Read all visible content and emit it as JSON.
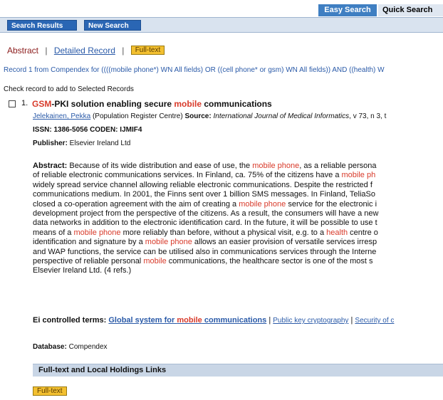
{
  "tabs_top": {
    "easy_search": "Easy Search",
    "quick_search": "Quick Search"
  },
  "nav": {
    "search_results": "Search Results",
    "new_search": "New Search"
  },
  "view_tabs": {
    "abstract": "Abstract",
    "separator": "|",
    "detailed": "Detailed Record",
    "fulltext": "Full-text"
  },
  "record_line": "Record 1 from Compendex for ((((mobile phone*) WN All fields) OR ((cell phone* or gsm) WN All fields)) AND ((health) W",
  "check_line": "Check record to add to Selected Records",
  "record": {
    "number": "1.",
    "title_hl": "GSM",
    "title_part1": "-PKI solution enabling secure ",
    "title_hl2": "mobile",
    "title_part2": " communications",
    "author": "Jelekainen, Pekka",
    "affiliation": " (Population Register Centre) ",
    "source_label": "Source:",
    "source_text": " International Journal of Medical Informatics",
    "source_tail": ", v 73, n 3, t",
    "issn_label": "ISSN:",
    "issn": " 1386-5056 ",
    "coden_label": "CODEN:",
    "coden": " IJMIF4",
    "publisher_label": "Publisher:",
    "publisher": " Elsevier Ireland Ltd",
    "abstract_label": "Abstract:",
    "abstract_lines": [
      [
        "Because of its wide distribution and ease of use, the ",
        "mobile phone",
        ", as a reliable persona"
      ],
      [
        "of reliable electronic communications services. In Finland, ca. 75% of the citizens have a ",
        "mobile ph",
        ""
      ],
      [
        "widely spread service channel allowing reliable electronic communications. Despite the restricted f",
        "",
        ""
      ],
      [
        "communications medium. In 2001, the Finns sent over 1 billion SMS messages. In Finland, TeliaSo",
        "",
        ""
      ],
      [
        "closed a co-operation agreement with the aim of creating a ",
        "mobile phone",
        " service for the electronic i"
      ],
      [
        "development project from the perspective of the citizens. As a result, the consumers will have a new",
        "",
        ""
      ],
      [
        "data networks in addition to the electronic identification card. In the future, it will be possible to use t",
        "",
        ""
      ],
      [
        "means of a ",
        "mobile phone",
        " more reliably than before, without a physical visit, e.g. to a "
      ],
      [
        "identification and signature by a ",
        "mobile phone",
        " allows an easier provision of versatile services irresp"
      ],
      [
        "and WAP functions, the service can be utilised also in communications services through the Interne",
        "",
        ""
      ],
      [
        "perspective of reliable personal ",
        "mobile",
        " communications, the healthcare sector is one of the most s"
      ],
      [
        "Elsevier Ireland Ltd. (4 refs.)",
        "",
        ""
      ]
    ],
    "health_word": "health",
    "health_tail": " centre o",
    "ei_label": "Ei controlled terms:",
    "ei_term1_pre": "Global system for ",
    "ei_term1_hl": "mobile",
    "ei_term1_post": " communications",
    "ei_sep1": " | ",
    "ei_term2": "Public key cryptography",
    "ei_sep2": " | ",
    "ei_term3": "Security of c",
    "database_label": "Database:",
    "database": " Compendex"
  },
  "holdings": {
    "title": "Full-text and Local Holdings Links",
    "fulltext": "Full-text"
  },
  "colors": {
    "highlight": "#d83a2a",
    "link": "#2a5aa8",
    "nav_button": "#2a66b4",
    "fulltext_badge": "#f3c030"
  }
}
